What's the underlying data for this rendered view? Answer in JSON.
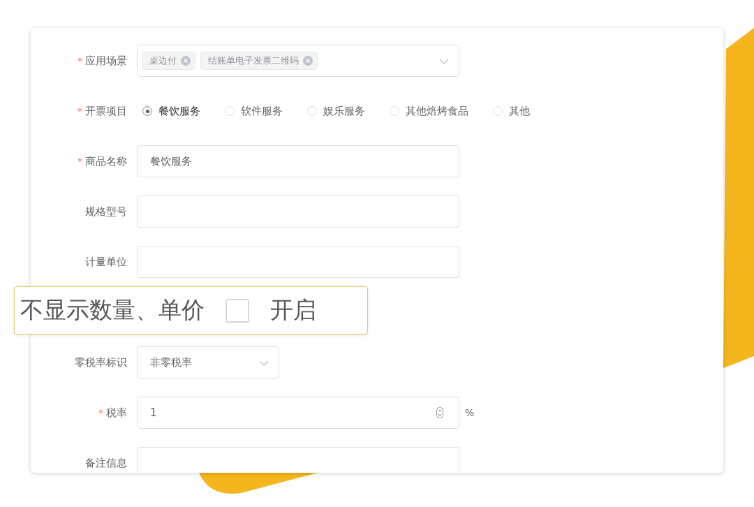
{
  "form": {
    "fields": [
      {
        "kind": "multiselect",
        "label": "应用场景",
        "marker": "*",
        "tags": [
          "桌边付",
          "结账单电子发票二维码"
        ]
      },
      {
        "kind": "radio",
        "label": "开票项目",
        "marker": "*",
        "options": [
          {
            "label": "餐饮服务",
            "selected": true
          },
          {
            "label": "软件服务",
            "selected": false
          },
          {
            "label": "娱乐服务",
            "selected": false
          },
          {
            "label": "其他焙烤食品",
            "selected": false
          },
          {
            "label": "其他",
            "selected": false
          }
        ]
      },
      {
        "kind": "text",
        "label": "商品名称",
        "marker": "*",
        "value": "餐饮服务"
      },
      {
        "kind": "text",
        "label": "规格型号"
      },
      {
        "kind": "text",
        "label": "计量单位"
      },
      {
        "kind": "callout",
        "label": "不显示数量、单价",
        "checked": false,
        "option": "开启"
      },
      {
        "kind": "select",
        "label": "零税率标识",
        "value": "非零税率"
      },
      {
        "kind": "number",
        "label": "税率",
        "marker": "*",
        "value": "1",
        "suffix": "%"
      },
      {
        "kind": "textarea",
        "label": "备注信息"
      }
    ]
  }
}
